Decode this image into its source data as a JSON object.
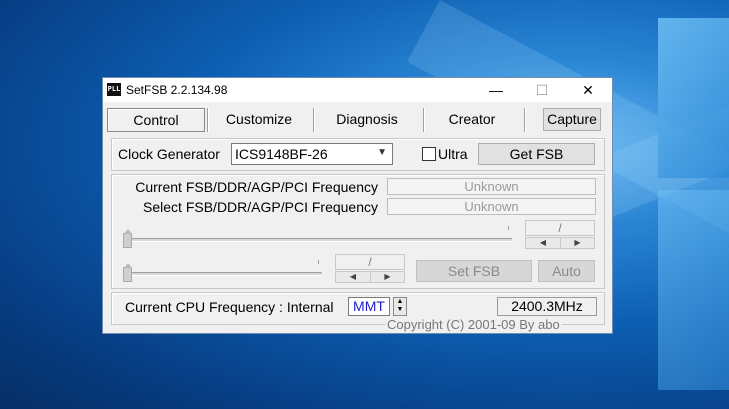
{
  "window": {
    "title": "SetFSB 2.2.134.98",
    "icon": "PLL",
    "controls": {
      "minimize": "—",
      "maximize": "☐",
      "close": "✕"
    }
  },
  "tabs": [
    {
      "label": "Control",
      "selected": true
    },
    {
      "label": "Customize",
      "selected": false
    },
    {
      "label": "Diagnosis",
      "selected": false
    },
    {
      "label": "Creator",
      "selected": false
    }
  ],
  "capture_label": "Capture",
  "clock": {
    "label": "Clock Generator",
    "value": "ICS9148BF-26",
    "ultra_label": "Ultra",
    "ultra_checked": false,
    "get_fsb_label": "Get FSB"
  },
  "frequency": {
    "current_label": "Current FSB/DDR/AGP/PCI Frequency",
    "current_value": "Unknown",
    "select_label": "Select FSB/DDR/AGP/PCI Frequency",
    "select_value": "Unknown",
    "ratio1": "/",
    "ratio2": "/",
    "set_fsb_label": "Set FSB",
    "auto_label": "Auto"
  },
  "cpu": {
    "label": "Current CPU Frequency : Internal",
    "mode": "MMT",
    "value": "2400.3MHz"
  },
  "copyright": "Copyright (C) 2001-09 By abo"
}
